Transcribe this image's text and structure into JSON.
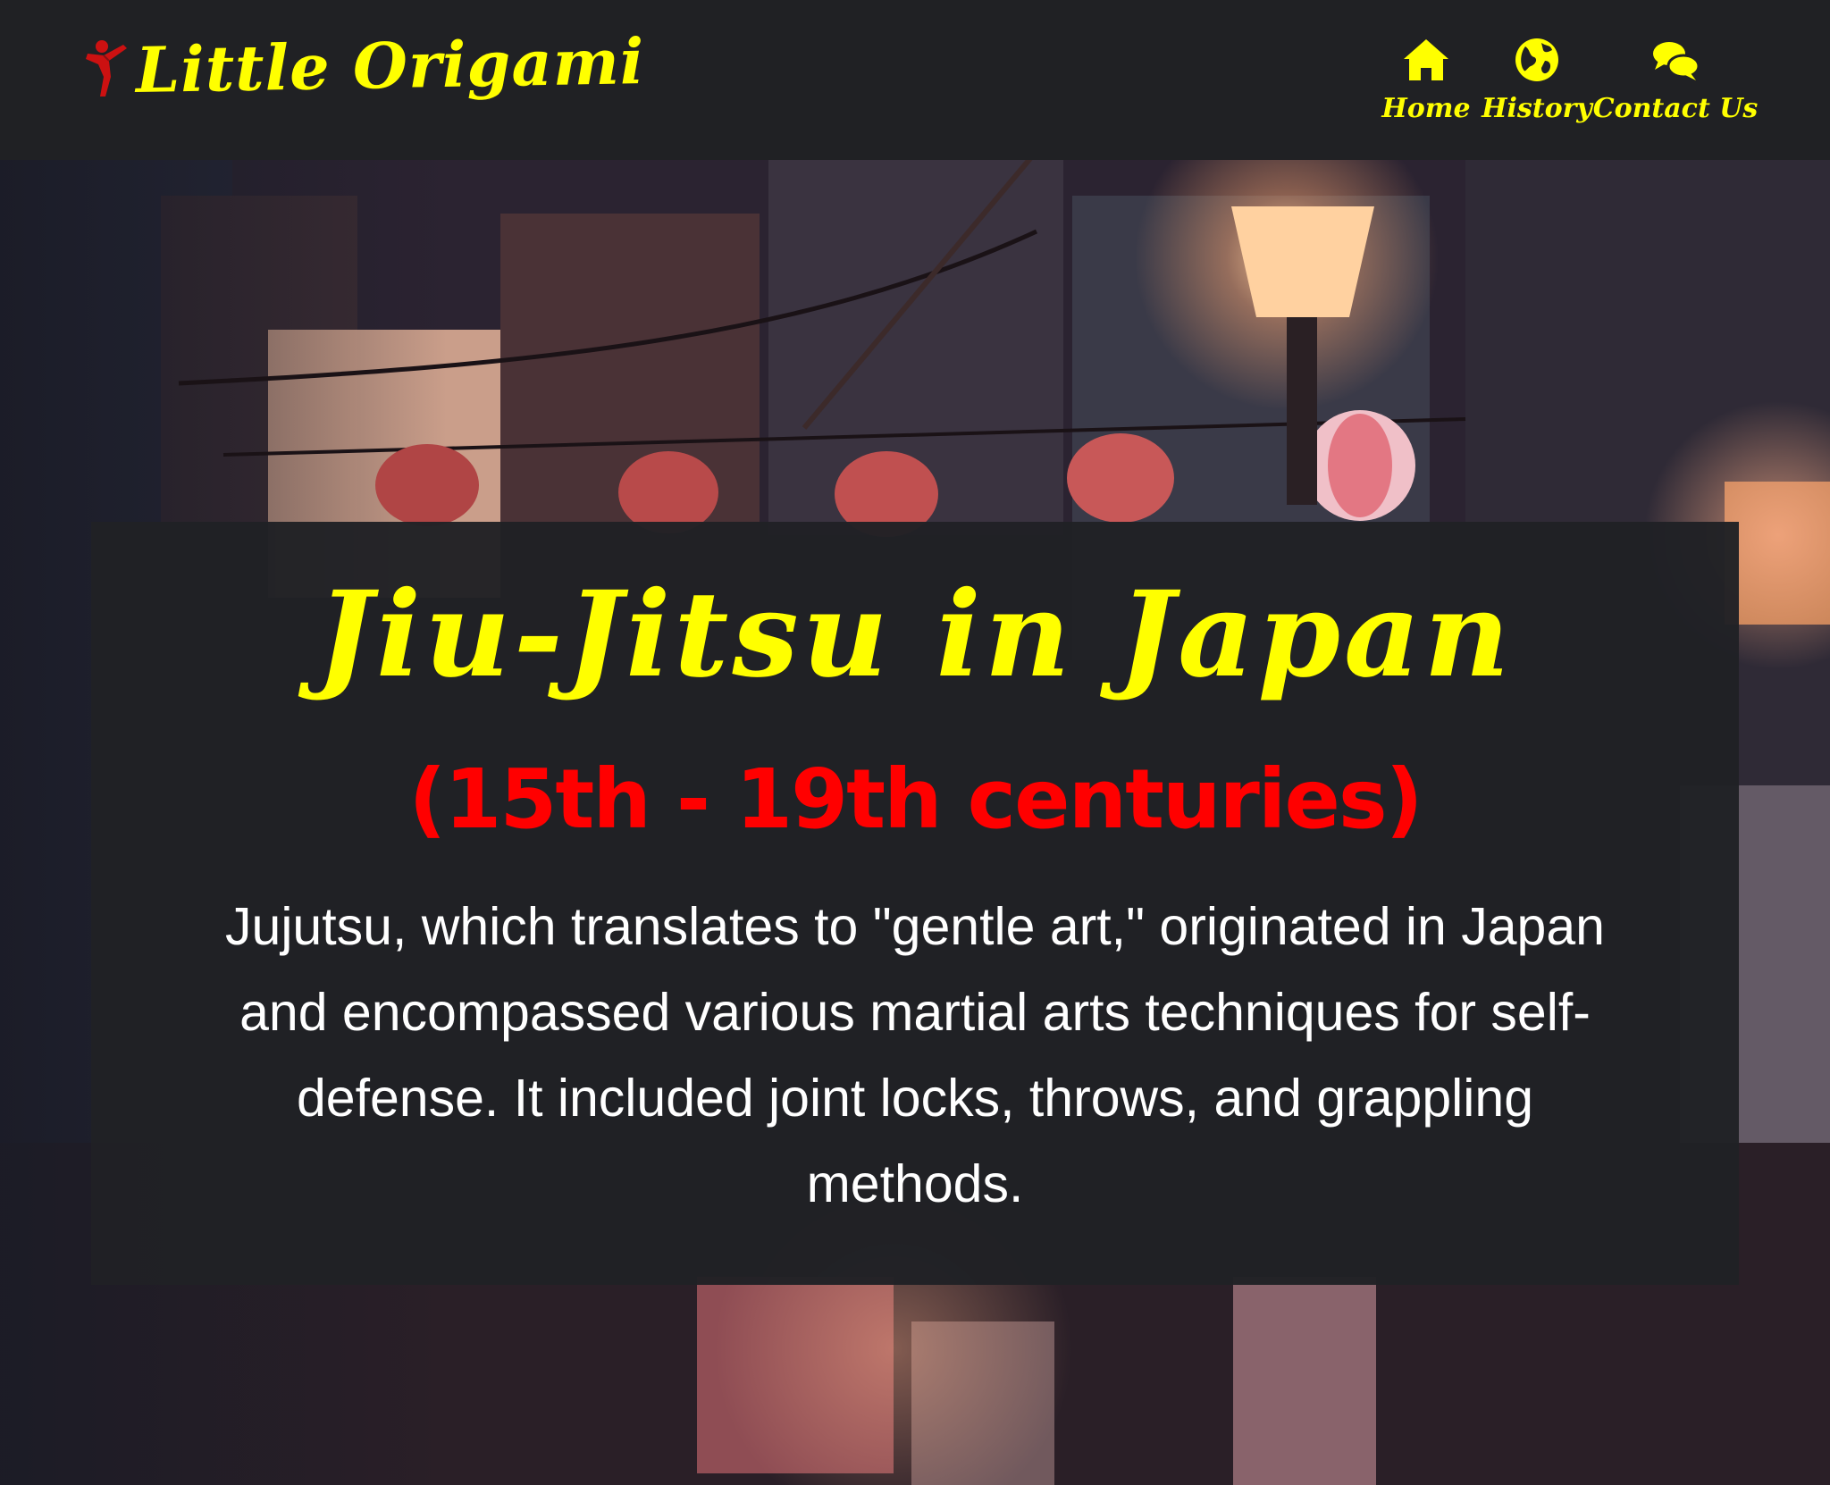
{
  "header": {
    "brand_name": "Little Origami",
    "brand_logo_icon": "karate-kick-icon",
    "nav": [
      {
        "label": "Home",
        "icon": "home-icon"
      },
      {
        "label": "History",
        "icon": "globe-icon"
      },
      {
        "label": "Contact Us",
        "icon": "chat-bubbles-icon"
      }
    ]
  },
  "hero": {
    "title": "Jiu-Jitsu in Japan",
    "subtitle": "(15th - 19th centuries)",
    "body": "Jujutsu, which translates to \"gentle art,\" originated in Japan and encompassed various martial arts techniques for self-defense. It included joint locks, throws, and grappling methods."
  },
  "colors": {
    "header_bg": "#202124",
    "accent_yellow": "#ffff00",
    "accent_red": "#ff0000",
    "card_bg": "#202125",
    "body_text": "#ffffff"
  }
}
